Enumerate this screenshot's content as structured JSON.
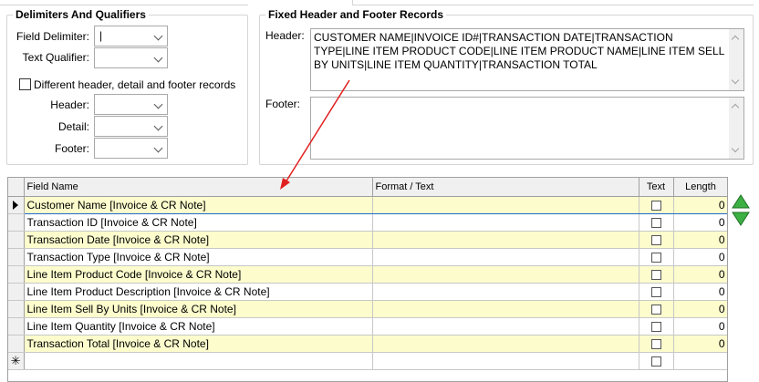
{
  "delimiters": {
    "title": "Delimiters And Qualifiers",
    "field_delimiter_label": "Field Delimiter:",
    "field_delimiter_value": "|",
    "text_qualifier_label": "Text Qualifier:",
    "text_qualifier_value": "",
    "different_records_label": "Different header, detail and footer records",
    "header_label": "Header:",
    "detail_label": "Detail:",
    "footer_label": "Footer:"
  },
  "fixed_records": {
    "title": "Fixed Header and Footer Records",
    "header_label": "Header:",
    "header_value": "CUSTOMER NAME|INVOICE ID#|TRANSACTION DATE|TRANSACTION TYPE|LINE ITEM PRODUCT CODE|LINE ITEM PRODUCT NAME|LINE ITEM SELL BY UNITS|LINE ITEM QUANTITY|TRANSACTION TOTAL",
    "footer_label": "Footer:",
    "footer_value": ""
  },
  "grid": {
    "columns": [
      "Field Name",
      "Format / Text",
      "Text",
      "Length"
    ],
    "rows": [
      {
        "field": "Customer Name [Invoice & CR Note]",
        "format": "",
        "length": "0"
      },
      {
        "field": "Transaction ID [Invoice & CR Note]",
        "format": "",
        "length": "0"
      },
      {
        "field": "Transaction Date  [Invoice & CR Note]",
        "format": "",
        "length": "0"
      },
      {
        "field": "Transaction Type [Invoice & CR Note]",
        "format": "",
        "length": "0"
      },
      {
        "field": "Line Item Product Code [Invoice & CR Note]",
        "format": "",
        "length": "0"
      },
      {
        "field": "Line Item Product Description [Invoice & CR Note]",
        "format": "",
        "length": "0"
      },
      {
        "field": "Line Item Sell By Units [Invoice & CR Note]",
        "format": "",
        "length": "0"
      },
      {
        "field": "Line Item Quantity [Invoice & CR Note]",
        "format": "",
        "length": "0"
      },
      {
        "field": "Transaction Total [Invoice & CR Note]",
        "format": "",
        "length": "0"
      }
    ],
    "new_row_marker": "✳"
  },
  "icons": {
    "move_up": "triangle-up-icon",
    "move_down": "triangle-down-icon",
    "annotation": "red-arrow-annotation"
  },
  "colors": {
    "highlight_row": "#fcfccd",
    "move_arrow": "#2e9e2e",
    "annotation_arrow": "#e02020"
  }
}
